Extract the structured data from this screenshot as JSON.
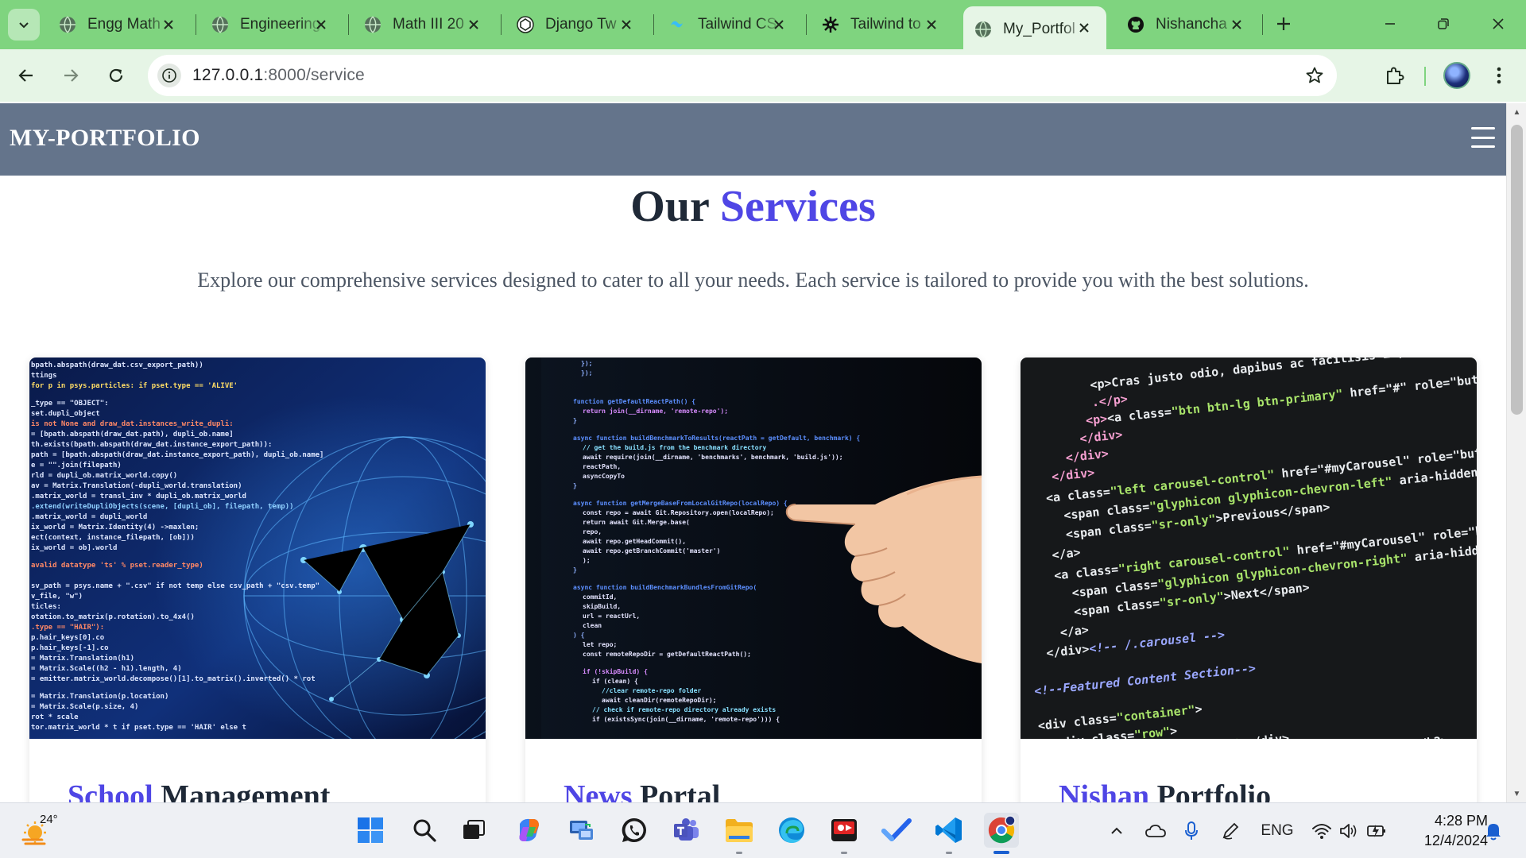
{
  "browser": {
    "tabs": [
      {
        "title": "Engg Math",
        "icon": "globe-icon",
        "active": false
      },
      {
        "title": "Engineering",
        "icon": "globe-icon",
        "active": false
      },
      {
        "title": "Math III 20",
        "icon": "globe-icon",
        "active": false
      },
      {
        "title": "Django Tw",
        "icon": "openai-icon",
        "active": false
      },
      {
        "title": "Tailwind CS",
        "icon": "tailwind-icon",
        "active": false
      },
      {
        "title": "Tailwind to",
        "icon": "gear-icon",
        "active": false
      },
      {
        "title": "My_Portfol",
        "icon": "globe-icon",
        "active": true
      },
      {
        "title": "Nishancha",
        "icon": "github-icon",
        "active": false
      }
    ],
    "address": {
      "host": "127.0.0.1",
      "rest": ":8000/service"
    }
  },
  "site": {
    "brand": "MY-PORTFOLIO",
    "heading": {
      "part1": "Our ",
      "part2": "Services"
    },
    "subtitle": "Explore our comprehensive services designed to cater to all your needs. Each service is tailored to provide you with the best solutions.",
    "cards": [
      {
        "title_accent": "School",
        "title_rest": " Management",
        "image": "python-code-globe-image"
      },
      {
        "title_accent": "News",
        "title_rest": " Portal",
        "image": "hand-pointing-at-code-image"
      },
      {
        "title_accent": "Nishan",
        "title_rest": " Portfolio",
        "image": "html-carousel-code-image"
      }
    ]
  },
  "taskbar": {
    "weather_temp": "24°",
    "language": "ENG",
    "time": "4:28 PM",
    "date": "12/4/2024"
  },
  "colors": {
    "tabstrip": "#7fd47f",
    "toolbar": "#e6f5e6",
    "site_nav": "#64748b",
    "accent": "#4f46e5",
    "heading": "#1f2937"
  }
}
